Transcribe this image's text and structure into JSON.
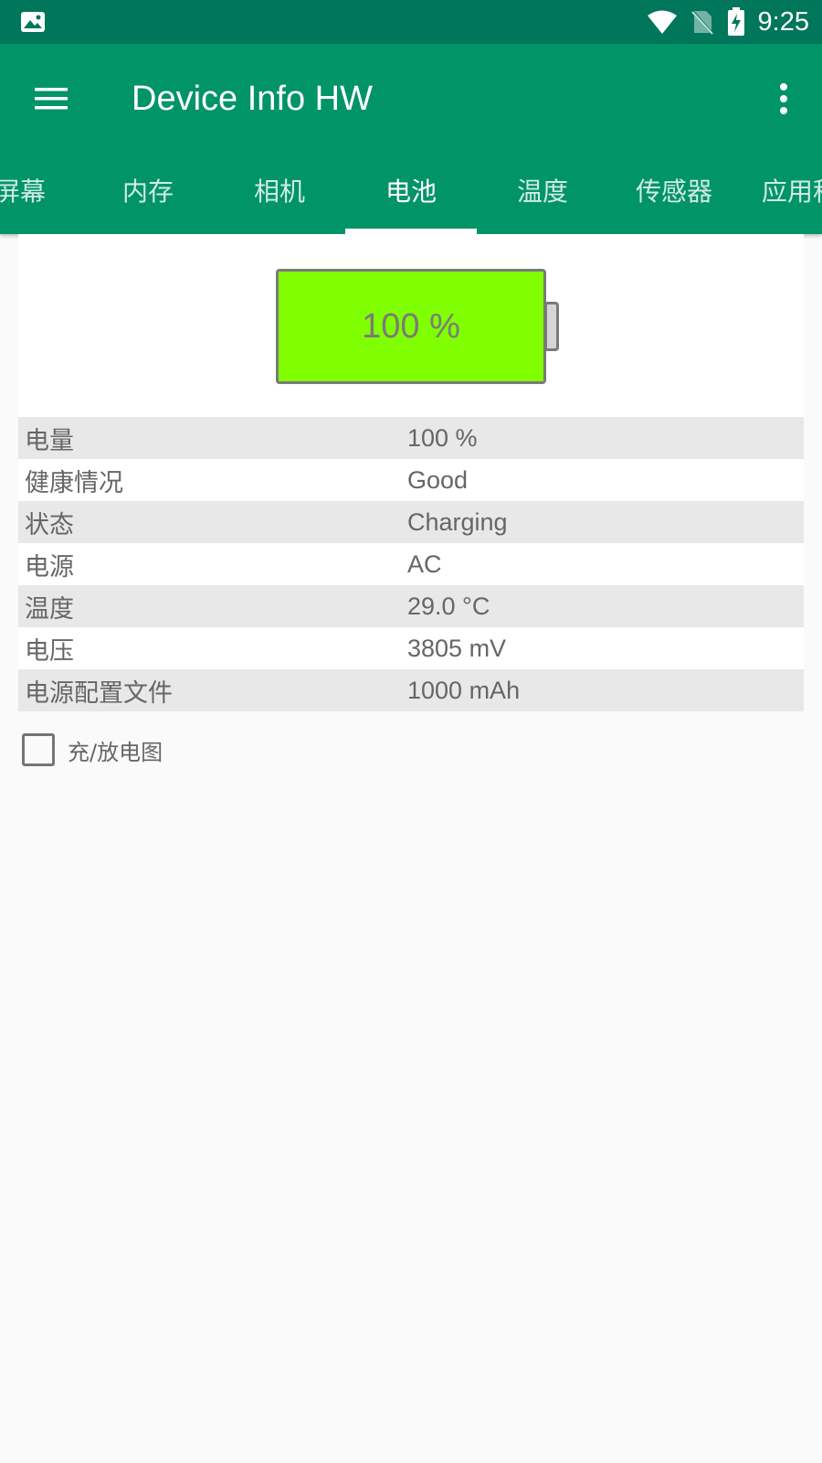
{
  "status_bar": {
    "time": "9:25",
    "icons": [
      "image-icon",
      "wifi-icon",
      "no-sim-icon",
      "battery-charging-icon"
    ]
  },
  "app_bar": {
    "title": "Device Info HW",
    "menu_icon": "menu-icon",
    "more_icon": "more-vert-icon"
  },
  "tabs": [
    {
      "label": "屏幕"
    },
    {
      "label": "内存"
    },
    {
      "label": "相机"
    },
    {
      "label": "电池"
    },
    {
      "label": "温度"
    },
    {
      "label": "传感器"
    },
    {
      "label": "应用程"
    }
  ],
  "active_tab": "电池",
  "battery": {
    "level_text": "100 %",
    "level": 1.0,
    "fill_color": "#80ff00"
  },
  "info_rows": [
    {
      "label": "电量",
      "value": "100 %"
    },
    {
      "label": "健康情况",
      "value": "Good"
    },
    {
      "label": "状态",
      "value": "Charging"
    },
    {
      "label": "电源",
      "value": "AC"
    },
    {
      "label": "温度",
      "value": "29.0 °C"
    },
    {
      "label": "电压",
      "value": "3805 mV"
    },
    {
      "label": "电源配置文件",
      "value": "1000 mAh"
    }
  ],
  "chart_toggle": {
    "label": "充/放电图",
    "checked": false
  },
  "colors": {
    "status_bar": "#00765a",
    "app_bar": "#009466",
    "background": "#fafafa",
    "row_shade": "#e8e8e8"
  }
}
